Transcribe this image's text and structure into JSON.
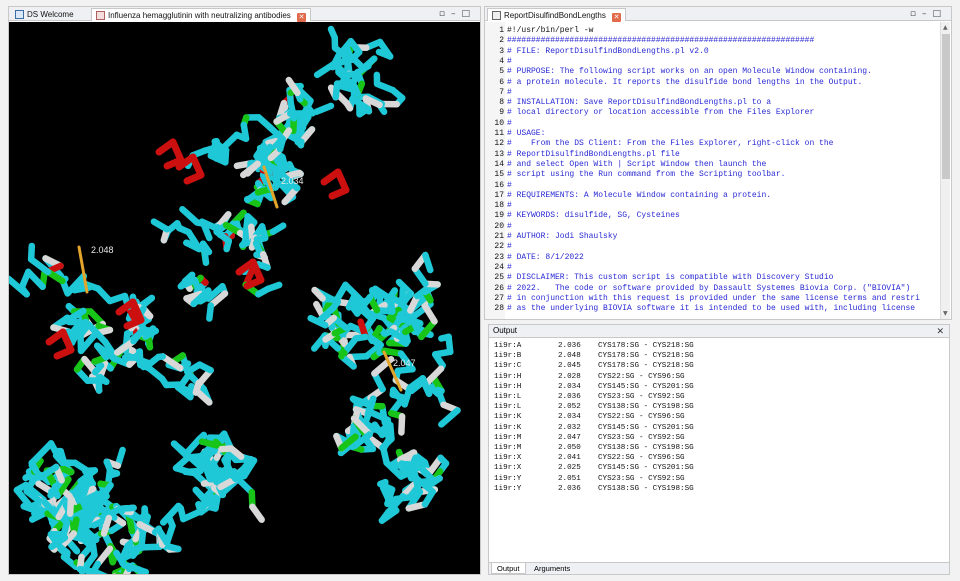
{
  "left_pane": {
    "tabs": [
      {
        "label": "DS Welcome"
      },
      {
        "label": "Influenza hemagglutinin with neutralizing antibodies"
      }
    ],
    "bond_labels": [
      "2.048",
      "2.034",
      "2.047"
    ],
    "colors": {
      "background": "#000000",
      "backbone": "#1fc8d6",
      "coil": "#d8d8d8",
      "strand": "#18c418",
      "helix": "#cc1010",
      "disulfide": "#e3a42b"
    }
  },
  "editor_pane": {
    "tab": {
      "label": "ReportDisulfindBondLengths"
    },
    "lines": [
      {
        "n": "1",
        "text": "#!/usr/bin/perl -w"
      },
      {
        "n": "2",
        "text": "################################################################"
      },
      {
        "n": "3",
        "text": "# FILE: ReportDisulfindBondLengths.pl v2.0"
      },
      {
        "n": "4",
        "text": "#"
      },
      {
        "n": "5",
        "text": "# PURPOSE: The following script works on an open Molecule Window containing."
      },
      {
        "n": "6",
        "text": "# a protein molecule. It reports the disulfide bond lengths in the Output."
      },
      {
        "n": "7",
        "text": "#"
      },
      {
        "n": "8",
        "text": "# INSTALLATION: Save ReportDisulfindBondLengths.pl to a"
      },
      {
        "n": "9",
        "text": "# local directory or location accessible from the Files Explorer"
      },
      {
        "n": "10",
        "text": "#"
      },
      {
        "n": "11",
        "text": "# USAGE:"
      },
      {
        "n": "12",
        "text": "#    From the DS Client: From the Files Explorer, right-click on the"
      },
      {
        "n": "13",
        "text": "# ReportDisulfindBondLengths.pl file"
      },
      {
        "n": "14",
        "text": "# and select Open With | Script Window then launch the"
      },
      {
        "n": "15",
        "text": "# script using the Run command from the Scripting toolbar."
      },
      {
        "n": "16",
        "text": "#"
      },
      {
        "n": "17",
        "text": "# REQUIREMENTS: A Molecule Window containing a protein."
      },
      {
        "n": "18",
        "text": "#"
      },
      {
        "n": "19",
        "text": "# KEYWORDS: disulfide, SG, Cysteines"
      },
      {
        "n": "20",
        "text": "#"
      },
      {
        "n": "21",
        "text": "# AUTHOR: Jodi Shaulsky"
      },
      {
        "n": "22",
        "text": "#"
      },
      {
        "n": "23",
        "text": "# DATE: 8/1/2022"
      },
      {
        "n": "24",
        "text": "#"
      },
      {
        "n": "25",
        "text": "# DISCLAIMER: This custom script is compatible with Discovery Studio"
      },
      {
        "n": "26",
        "text": "# 2022.   The code or software provided by Dassault Systemes Biovia Corp. (\"BIOVIA\")"
      },
      {
        "n": "27",
        "text": "# in conjunction with this request is provided under the same license terms and restri"
      },
      {
        "n": "28",
        "text": "# as the underlying BIOVIA software it is intended to be used with, including license"
      }
    ]
  },
  "output_pane": {
    "title": "Output",
    "rows": [
      {
        "chain": "1i9r:A",
        "length": "2.036",
        "pair": "CYS178:SG - CYS218:SG"
      },
      {
        "chain": "1i9r:B",
        "length": "2.048",
        "pair": "CYS178:SG - CYS218:SG"
      },
      {
        "chain": "1i9r:C",
        "length": "2.045",
        "pair": "CYS178:SG - CYS218:SG"
      },
      {
        "chain": "1i9r:H",
        "length": "2.028",
        "pair": "CYS22:SG - CYS96:SG"
      },
      {
        "chain": "1i9r:H",
        "length": "2.034",
        "pair": "CYS145:SG - CYS201:SG"
      },
      {
        "chain": "1i9r:L",
        "length": "2.036",
        "pair": "CYS23:SG - CYS92:SG"
      },
      {
        "chain": "1i9r:L",
        "length": "2.052",
        "pair": "CYS138:SG - CYS198:SG"
      },
      {
        "chain": "1i9r:K",
        "length": "2.034",
        "pair": "CYS22:SG - CYS96:SG"
      },
      {
        "chain": "1i9r:K",
        "length": "2.032",
        "pair": "CYS145:SG - CYS201:SG"
      },
      {
        "chain": "1i9r:M",
        "length": "2.047",
        "pair": "CYS23:SG - CYS92:SG"
      },
      {
        "chain": "1i9r:M",
        "length": "2.050",
        "pair": "CYS138:SG - CYS198:SG"
      },
      {
        "chain": "1i9r:X",
        "length": "2.041",
        "pair": "CYS22:SG - CYS96:SG"
      },
      {
        "chain": "1i9r:X",
        "length": "2.025",
        "pair": "CYS145:SG - CYS201:SG"
      },
      {
        "chain": "1i9r:Y",
        "length": "2.051",
        "pair": "CYS23:SG - CYS92:SG"
      },
      {
        "chain": "1i9r:Y",
        "length": "2.036",
        "pair": "CYS138:SG - CYS198:SG"
      }
    ],
    "tabs": [
      {
        "label": "Output"
      },
      {
        "label": "Arguments"
      }
    ]
  }
}
